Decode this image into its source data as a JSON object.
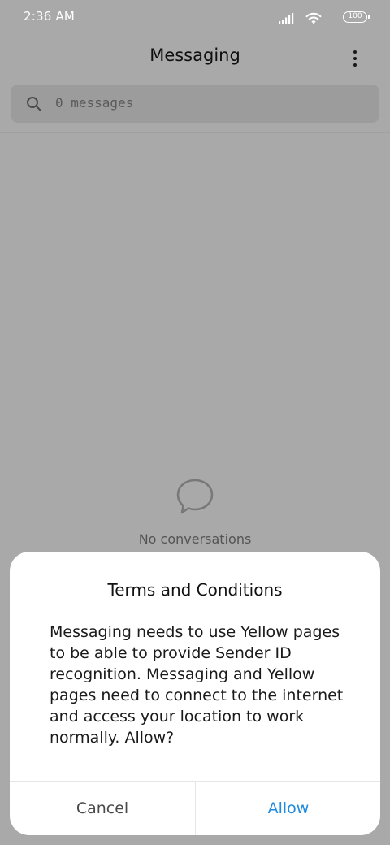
{
  "status_bar": {
    "time": "2:36 AM",
    "battery": "100",
    "icons": [
      "signal-icon",
      "wifi-icon",
      "battery-icon"
    ]
  },
  "header": {
    "title": "Messaging",
    "more_icon": "more-vert-icon"
  },
  "search": {
    "placeholder": "0 messages",
    "icon": "search-icon"
  },
  "empty_state": {
    "icon": "chat-bubble-icon",
    "text": "No conversations"
  },
  "dialog": {
    "title": "Terms and Conditions",
    "body": "Messaging needs to use Yellow pages to be able to provide Sender ID recognition. Messaging and Yellow pages need to connect to the internet and access your location to work normally. Allow?",
    "cancel_label": "Cancel",
    "allow_label": "Allow"
  },
  "colors": {
    "scrim_background": "#a9a9a9",
    "dialog_background": "#ffffff",
    "accent": "#1e8be0"
  }
}
